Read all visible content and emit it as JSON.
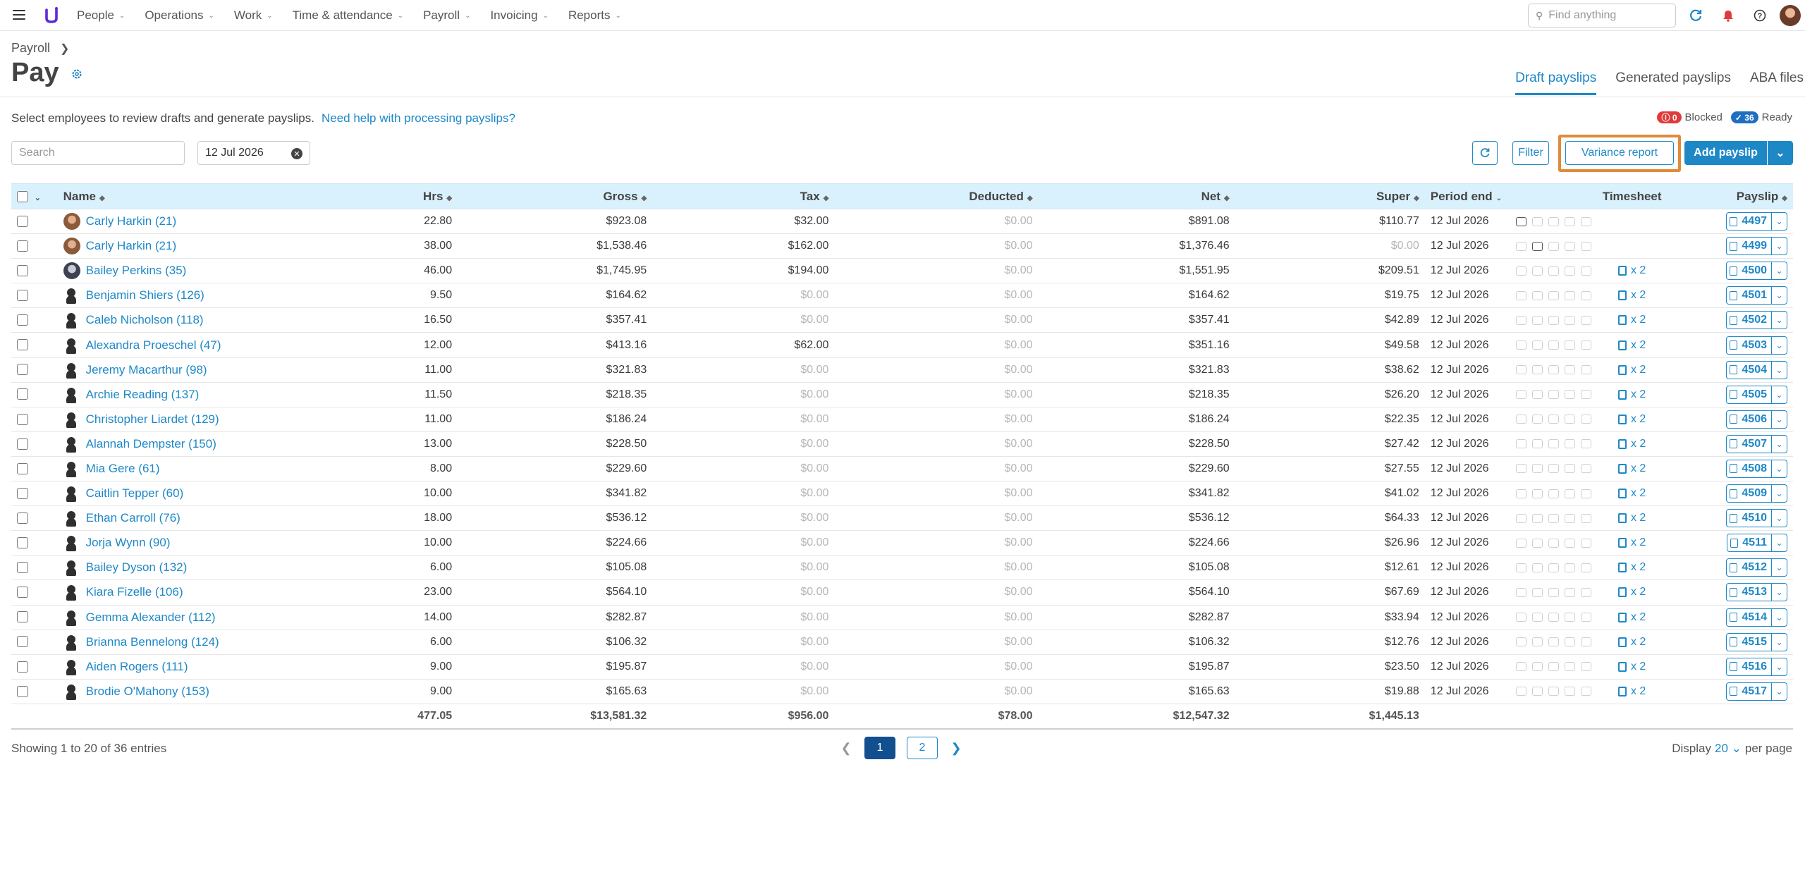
{
  "nav": {
    "items": [
      "People",
      "Operations",
      "Work",
      "Time & attendance",
      "Payroll",
      "Invoicing",
      "Reports"
    ],
    "search_placeholder": "Find anything"
  },
  "header": {
    "breadcrumb": "Payroll",
    "title": "Pay",
    "tabs": [
      "Draft payslips",
      "Generated payslips",
      "ABA files"
    ],
    "intro": "Select employees to review drafts and generate payslips.",
    "help_link": "Need help with processing payslips?",
    "blocked_count": "0",
    "blocked_label": "Blocked",
    "ready_count": "36",
    "ready_label": "Ready"
  },
  "filters": {
    "search_placeholder": "Search",
    "date": "12 Jul 2026",
    "filter_label": "Filter",
    "variance_label": "Variance report",
    "add_label": "Add payslip"
  },
  "table": {
    "headers": [
      "Name",
      "Hrs",
      "Gross",
      "Tax",
      "Deducted",
      "Net",
      "Super",
      "Period end",
      "Timesheet",
      "Payslip"
    ],
    "rows": [
      {
        "name": "Carly Harkin (21)",
        "hrs": "22.80",
        "gross": "$923.08",
        "tax": "$32.00",
        "ded": "$0.00",
        "net": "$891.08",
        "super": "$110.77",
        "period": "12 Jul 2026",
        "ts": "",
        "payslip": "4497",
        "avatar": "photo-a",
        "first_icon_dark": true,
        "second_icon_dark": false
      },
      {
        "name": "Carly Harkin (21)",
        "hrs": "38.00",
        "gross": "$1,538.46",
        "tax": "$162.00",
        "ded": "$0.00",
        "net": "$1,376.46",
        "super": "$0.00",
        "period": "12 Jul 2026",
        "ts": "",
        "payslip": "4499",
        "avatar": "photo-a",
        "first_icon_dark": false,
        "second_icon_dark": true
      },
      {
        "name": "Bailey Perkins (35)",
        "hrs": "46.00",
        "gross": "$1,745.95",
        "tax": "$194.00",
        "ded": "$0.00",
        "net": "$1,551.95",
        "super": "$209.51",
        "period": "12 Jul 2026",
        "ts": "x 2",
        "payslip": "4500",
        "avatar": "photo-b"
      },
      {
        "name": "Benjamin Shiers (126)",
        "hrs": "9.50",
        "gross": "$164.62",
        "tax": "$0.00",
        "ded": "$0.00",
        "net": "$164.62",
        "super": "$19.75",
        "period": "12 Jul 2026",
        "ts": "x 2",
        "payslip": "4501"
      },
      {
        "name": "Caleb Nicholson (118)",
        "hrs": "16.50",
        "gross": "$357.41",
        "tax": "$0.00",
        "ded": "$0.00",
        "net": "$357.41",
        "super": "$42.89",
        "period": "12 Jul 2026",
        "ts": "x 2",
        "payslip": "4502"
      },
      {
        "name": "Alexandra Proeschel (47)",
        "hrs": "12.00",
        "gross": "$413.16",
        "tax": "$62.00",
        "ded": "$0.00",
        "net": "$351.16",
        "super": "$49.58",
        "period": "12 Jul 2026",
        "ts": "x 2",
        "payslip": "4503"
      },
      {
        "name": "Jeremy Macarthur (98)",
        "hrs": "11.00",
        "gross": "$321.83",
        "tax": "$0.00",
        "ded": "$0.00",
        "net": "$321.83",
        "super": "$38.62",
        "period": "12 Jul 2026",
        "ts": "x 2",
        "payslip": "4504"
      },
      {
        "name": "Archie Reading (137)",
        "hrs": "11.50",
        "gross": "$218.35",
        "tax": "$0.00",
        "ded": "$0.00",
        "net": "$218.35",
        "super": "$26.20",
        "period": "12 Jul 2026",
        "ts": "x 2",
        "payslip": "4505"
      },
      {
        "name": "Christopher Liardet (129)",
        "hrs": "11.00",
        "gross": "$186.24",
        "tax": "$0.00",
        "ded": "$0.00",
        "net": "$186.24",
        "super": "$22.35",
        "period": "12 Jul 2026",
        "ts": "x 2",
        "payslip": "4506"
      },
      {
        "name": "Alannah Dempster (150)",
        "hrs": "13.00",
        "gross": "$228.50",
        "tax": "$0.00",
        "ded": "$0.00",
        "net": "$228.50",
        "super": "$27.42",
        "period": "12 Jul 2026",
        "ts": "x 2",
        "payslip": "4507"
      },
      {
        "name": "Mia Gere (61)",
        "hrs": "8.00",
        "gross": "$229.60",
        "tax": "$0.00",
        "ded": "$0.00",
        "net": "$229.60",
        "super": "$27.55",
        "period": "12 Jul 2026",
        "ts": "x 2",
        "payslip": "4508"
      },
      {
        "name": "Caitlin Tepper (60)",
        "hrs": "10.00",
        "gross": "$341.82",
        "tax": "$0.00",
        "ded": "$0.00",
        "net": "$341.82",
        "super": "$41.02",
        "period": "12 Jul 2026",
        "ts": "x 2",
        "payslip": "4509"
      },
      {
        "name": "Ethan Carroll (76)",
        "hrs": "18.00",
        "gross": "$536.12",
        "tax": "$0.00",
        "ded": "$0.00",
        "net": "$536.12",
        "super": "$64.33",
        "period": "12 Jul 2026",
        "ts": "x 2",
        "payslip": "4510"
      },
      {
        "name": "Jorja Wynn (90)",
        "hrs": "10.00",
        "gross": "$224.66",
        "tax": "$0.00",
        "ded": "$0.00",
        "net": "$224.66",
        "super": "$26.96",
        "period": "12 Jul 2026",
        "ts": "x 2",
        "payslip": "4511"
      },
      {
        "name": "Bailey Dyson (132)",
        "hrs": "6.00",
        "gross": "$105.08",
        "tax": "$0.00",
        "ded": "$0.00",
        "net": "$105.08",
        "super": "$12.61",
        "period": "12 Jul 2026",
        "ts": "x 2",
        "payslip": "4512"
      },
      {
        "name": "Kiara Fizelle (106)",
        "hrs": "23.00",
        "gross": "$564.10",
        "tax": "$0.00",
        "ded": "$0.00",
        "net": "$564.10",
        "super": "$67.69",
        "period": "12 Jul 2026",
        "ts": "x 2",
        "payslip": "4513"
      },
      {
        "name": "Gemma Alexander (112)",
        "hrs": "14.00",
        "gross": "$282.87",
        "tax": "$0.00",
        "ded": "$0.00",
        "net": "$282.87",
        "super": "$33.94",
        "period": "12 Jul 2026",
        "ts": "x 2",
        "payslip": "4514"
      },
      {
        "name": "Brianna Bennelong (124)",
        "hrs": "6.00",
        "gross": "$106.32",
        "tax": "$0.00",
        "ded": "$0.00",
        "net": "$106.32",
        "super": "$12.76",
        "period": "12 Jul 2026",
        "ts": "x 2",
        "payslip": "4515"
      },
      {
        "name": "Aiden Rogers (111)",
        "hrs": "9.00",
        "gross": "$195.87",
        "tax": "$0.00",
        "ded": "$0.00",
        "net": "$195.87",
        "super": "$23.50",
        "period": "12 Jul 2026",
        "ts": "x 2",
        "payslip": "4516"
      },
      {
        "name": "Brodie O'Mahony (153)",
        "hrs": "9.00",
        "gross": "$165.63",
        "tax": "$0.00",
        "ded": "$0.00",
        "net": "$165.63",
        "super": "$19.88",
        "period": "12 Jul 2026",
        "ts": "x 2",
        "payslip": "4517"
      }
    ],
    "totals": {
      "hrs": "477.05",
      "gross": "$13,581.32",
      "tax": "$956.00",
      "ded": "$78.00",
      "net": "$12,547.32",
      "super": "$1,445.13"
    }
  },
  "footer": {
    "showing": "Showing 1 to 20 of 36 entries",
    "pages": [
      "1",
      "2"
    ],
    "display_label": "Display",
    "display_value": "20",
    "per_page": "per page"
  },
  "colors": {
    "accent": "#1e88c7",
    "highlight": "#e08a3a",
    "header_bg": "#d9f1fc"
  }
}
